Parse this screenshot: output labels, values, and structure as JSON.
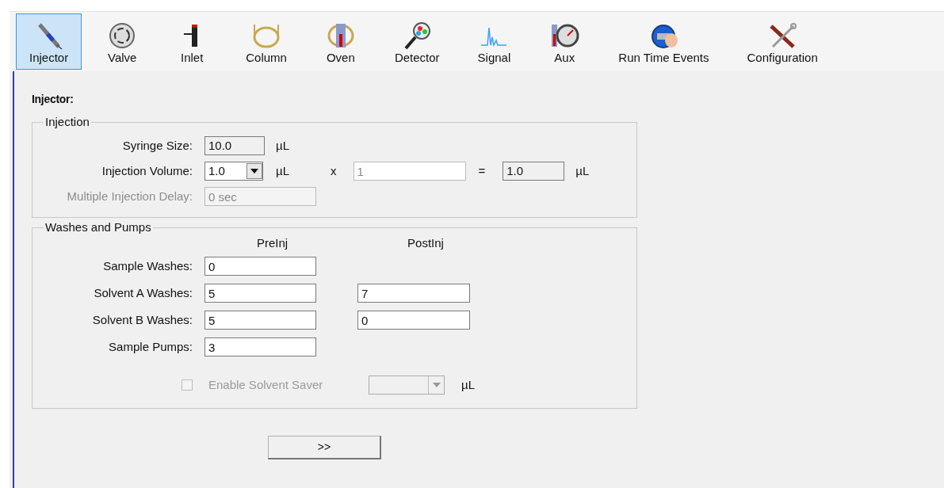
{
  "toolbar": [
    {
      "label": "Injector",
      "selected": true
    },
    {
      "label": "Valve",
      "selected": false
    },
    {
      "label": "Inlet",
      "selected": false
    },
    {
      "label": "Column",
      "selected": false
    },
    {
      "label": "Oven",
      "selected": false
    },
    {
      "label": "Detector",
      "selected": false
    },
    {
      "label": "Signal",
      "selected": false
    },
    {
      "label": "Aux",
      "selected": false
    },
    {
      "label": "Run Time Events",
      "selected": false
    },
    {
      "label": "Configuration",
      "selected": false
    }
  ],
  "panel_title": "Injector:",
  "injection": {
    "legend": "Injection",
    "syringe_size": {
      "label": "Syringe Size:",
      "value": "10.0",
      "unit": "µL"
    },
    "injection_volume": {
      "label": "Injection Volume:",
      "value": "1.0",
      "unit": "µL"
    },
    "multiplier": {
      "symbol": "x",
      "value": "1",
      "disabled": true
    },
    "equals": "=",
    "total": {
      "value": "1.0",
      "unit": "µL"
    },
    "delay": {
      "label": "Multiple Injection Delay:",
      "value": "0 sec",
      "disabled": true
    }
  },
  "washes": {
    "legend": "Washes and Pumps",
    "columns": [
      "PreInj",
      "PostInj"
    ],
    "rows": [
      {
        "label": "Sample Washes:",
        "pre": "0"
      },
      {
        "label": "Solvent A Washes:",
        "pre": "5",
        "post": "7"
      },
      {
        "label": "Solvent B Washes:",
        "pre": "5",
        "post": "0"
      },
      {
        "label": "Sample Pumps:",
        "pre": "3"
      }
    ],
    "solvent_saver": {
      "label": "Enable Solvent Saver",
      "checked": false,
      "disabled": true,
      "unit": "µL"
    }
  },
  "next_button": ">>"
}
